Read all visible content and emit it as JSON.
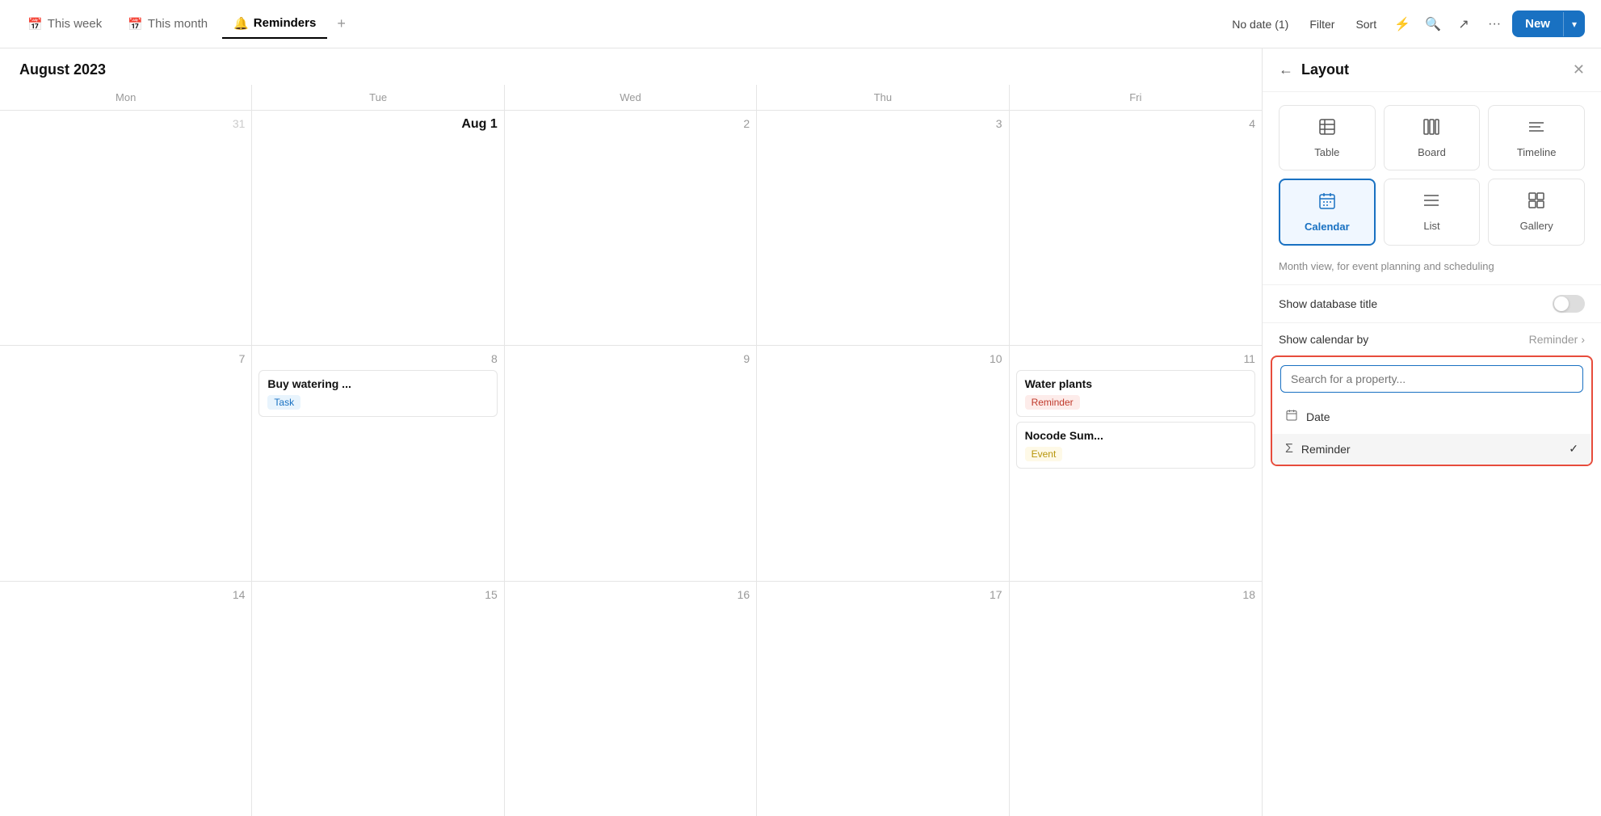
{
  "topbar": {
    "tabs": [
      {
        "id": "this-week",
        "label": "This week",
        "icon": "📅",
        "active": false
      },
      {
        "id": "this-month",
        "label": "This month",
        "icon": "📅",
        "active": false
      },
      {
        "id": "reminders",
        "label": "Reminders",
        "icon": "🔔",
        "active": true
      }
    ],
    "add_label": "+",
    "no_date_label": "No date (1)",
    "filter_label": "Filter",
    "sort_label": "Sort",
    "flash_icon": "⚡",
    "search_icon": "🔍",
    "arrow_icon": "↗",
    "more_icon": "···",
    "new_label": "New",
    "new_arrow": "▾"
  },
  "calendar": {
    "month_year": "August 2023",
    "day_headers": [
      "Mon",
      "Tue",
      "Wed",
      "Thu",
      "Fri"
    ],
    "rows": [
      {
        "cells": [
          {
            "date": "31",
            "faded": true,
            "events": []
          },
          {
            "date": "Aug 1",
            "bold": true,
            "events": []
          },
          {
            "date": "2",
            "events": []
          },
          {
            "date": "3",
            "events": []
          },
          {
            "date": "4",
            "events": []
          }
        ]
      },
      {
        "cells": [
          {
            "date": "7",
            "events": []
          },
          {
            "date": "8",
            "events": [
              {
                "title": "Buy watering ...",
                "tag": "Task",
                "tagClass": "tag-task"
              }
            ]
          },
          {
            "date": "9",
            "events": []
          },
          {
            "date": "10",
            "events": []
          },
          {
            "date": "11",
            "events": [
              {
                "title": "Water plants",
                "tag": "Reminder",
                "tagClass": "tag-reminder"
              },
              {
                "title": "Nocode Sum...",
                "tag": "Event",
                "tagClass": "tag-event"
              }
            ]
          }
        ]
      },
      {
        "cells": [
          {
            "date": "14",
            "events": []
          },
          {
            "date": "15",
            "events": []
          },
          {
            "date": "16",
            "events": []
          },
          {
            "date": "17",
            "events": []
          },
          {
            "date": "18",
            "events": []
          }
        ]
      }
    ]
  },
  "layout_panel": {
    "title": "Layout",
    "back_icon": "←",
    "close_icon": "✕",
    "options": [
      {
        "id": "table",
        "label": "Table",
        "icon": "⊞",
        "active": false
      },
      {
        "id": "board",
        "label": "Board",
        "icon": "⫿",
        "active": false
      },
      {
        "id": "timeline",
        "label": "Timeline",
        "icon": "≡",
        "active": false
      },
      {
        "id": "calendar",
        "label": "Calendar",
        "icon": "📅",
        "active": true
      },
      {
        "id": "list",
        "label": "List",
        "icon": "☰",
        "active": false
      },
      {
        "id": "gallery",
        "label": "Gallery",
        "icon": "⊟",
        "active": false
      }
    ],
    "description": "Month view, for event planning and scheduling",
    "show_db_title_label": "Show database title",
    "show_calendar_by_label": "Show calendar by",
    "show_calendar_by_value": "Reminder",
    "search_placeholder": "Search for a property...",
    "dropdown_items": [
      {
        "id": "date",
        "label": "Date",
        "icon": "📅",
        "selected": false
      },
      {
        "id": "reminder",
        "label": "Reminder",
        "icon": "Σ",
        "selected": true
      }
    ]
  }
}
